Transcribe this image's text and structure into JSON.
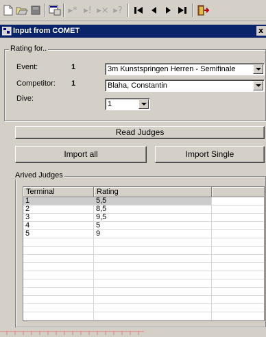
{
  "toolbar": {
    "icons": [
      "new-icon",
      "open-icon",
      "save-icon",
      "properties-icon",
      "add-record-icon",
      "execute-icon",
      "delete-record-icon",
      "query-icon",
      "first-record-icon",
      "previous-record-icon",
      "next-record-icon",
      "last-record-icon",
      "exit-icon"
    ]
  },
  "window": {
    "title": "Input from COMET",
    "close": "x"
  },
  "rating": {
    "legend": "Rating for..",
    "event_label": "Event:",
    "event_num": "1",
    "event_value": "3m Kunstspringen Herren - Semifinale",
    "competitor_label": "Competitor:",
    "competitor_num": "1",
    "competitor_value": "Blaha, Constantin",
    "dive_label": "Dive:",
    "dive_value": "1"
  },
  "buttons": {
    "read_judges": "Read Judges",
    "import_all": "Import all",
    "import_single": "Import Single"
  },
  "judges": {
    "legend": "Arived Judges",
    "columns": [
      "Terminal",
      "Rating",
      ""
    ],
    "rows": [
      {
        "terminal": "1",
        "rating": "5,5"
      },
      {
        "terminal": "2",
        "rating": "8,5"
      },
      {
        "terminal": "3",
        "rating": "9,5"
      },
      {
        "terminal": "4",
        "rating": "5"
      },
      {
        "terminal": "5",
        "rating": "9"
      }
    ]
  },
  "colors": {
    "title_bar": "#0a246a",
    "face": "#d4d0c8",
    "selection": "#cccccc"
  }
}
